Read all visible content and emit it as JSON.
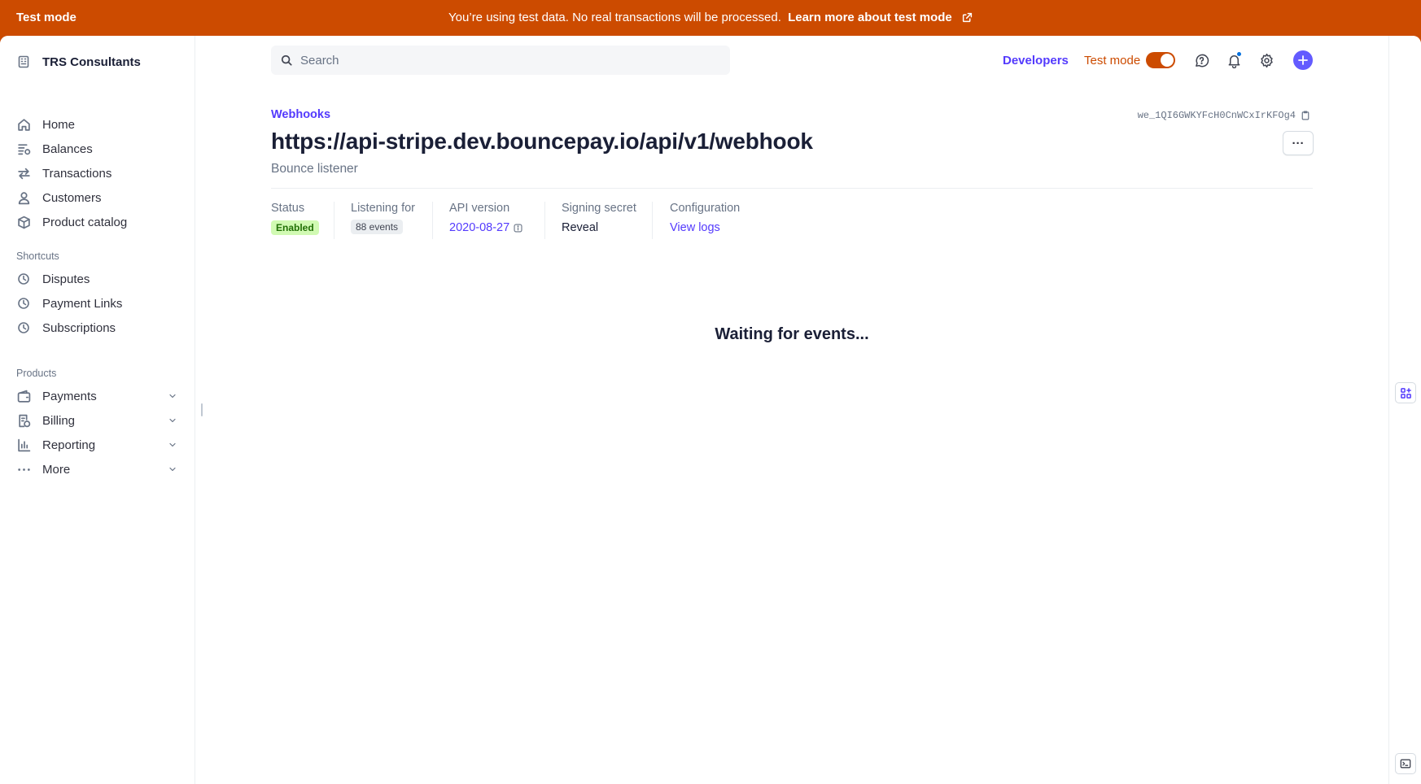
{
  "banner": {
    "title": "Test mode",
    "message": "You’re using test data. No real transactions will be processed.",
    "learn_more": "Learn more about test mode",
    "icon": "external-link-icon",
    "color": "#cc4b00"
  },
  "sidebar": {
    "account_name": "TRS Consultants",
    "main_items": [
      {
        "label": "Home",
        "icon": "home-icon"
      },
      {
        "label": "Balances",
        "icon": "balances-icon"
      },
      {
        "label": "Transactions",
        "icon": "transactions-icon"
      },
      {
        "label": "Customers",
        "icon": "customer-icon"
      },
      {
        "label": "Product catalog",
        "icon": "box-icon"
      }
    ],
    "shortcuts_title": "Shortcuts",
    "shortcuts": [
      {
        "label": "Disputes",
        "icon": "clock-icon"
      },
      {
        "label": "Payment Links",
        "icon": "clock-icon"
      },
      {
        "label": "Subscriptions",
        "icon": "clock-icon"
      }
    ],
    "products_title": "Products",
    "products": [
      {
        "label": "Payments",
        "icon": "wallet-icon"
      },
      {
        "label": "Billing",
        "icon": "billing-icon"
      },
      {
        "label": "Reporting",
        "icon": "bar-chart-icon"
      },
      {
        "label": "More",
        "icon": "more-dots-icon"
      }
    ]
  },
  "topbar": {
    "search_placeholder": "Search",
    "developers": "Developers",
    "test_mode_label": "Test mode",
    "test_mode_on": true,
    "accent": "#533afd"
  },
  "header": {
    "breadcrumb": "Webhooks",
    "endpoint_id": "we_1QI6GWKYFcH0CnWCxIrKFOg4",
    "url": "https://api-stripe.dev.bouncepay.io/api/v1/webhook",
    "description": "Bounce listener",
    "more_label": "···"
  },
  "meta": {
    "status_label": "Status",
    "status_value": "Enabled",
    "listening_label": "Listening for",
    "listening_value": "88 events",
    "api_version_label": "API version",
    "api_version_value": "2020-08-27",
    "signing_secret_label": "Signing secret",
    "signing_secret_value": "Reveal",
    "configuration_label": "Configuration",
    "configuration_value": "View logs"
  },
  "main": {
    "empty_message": "Waiting for events..."
  }
}
